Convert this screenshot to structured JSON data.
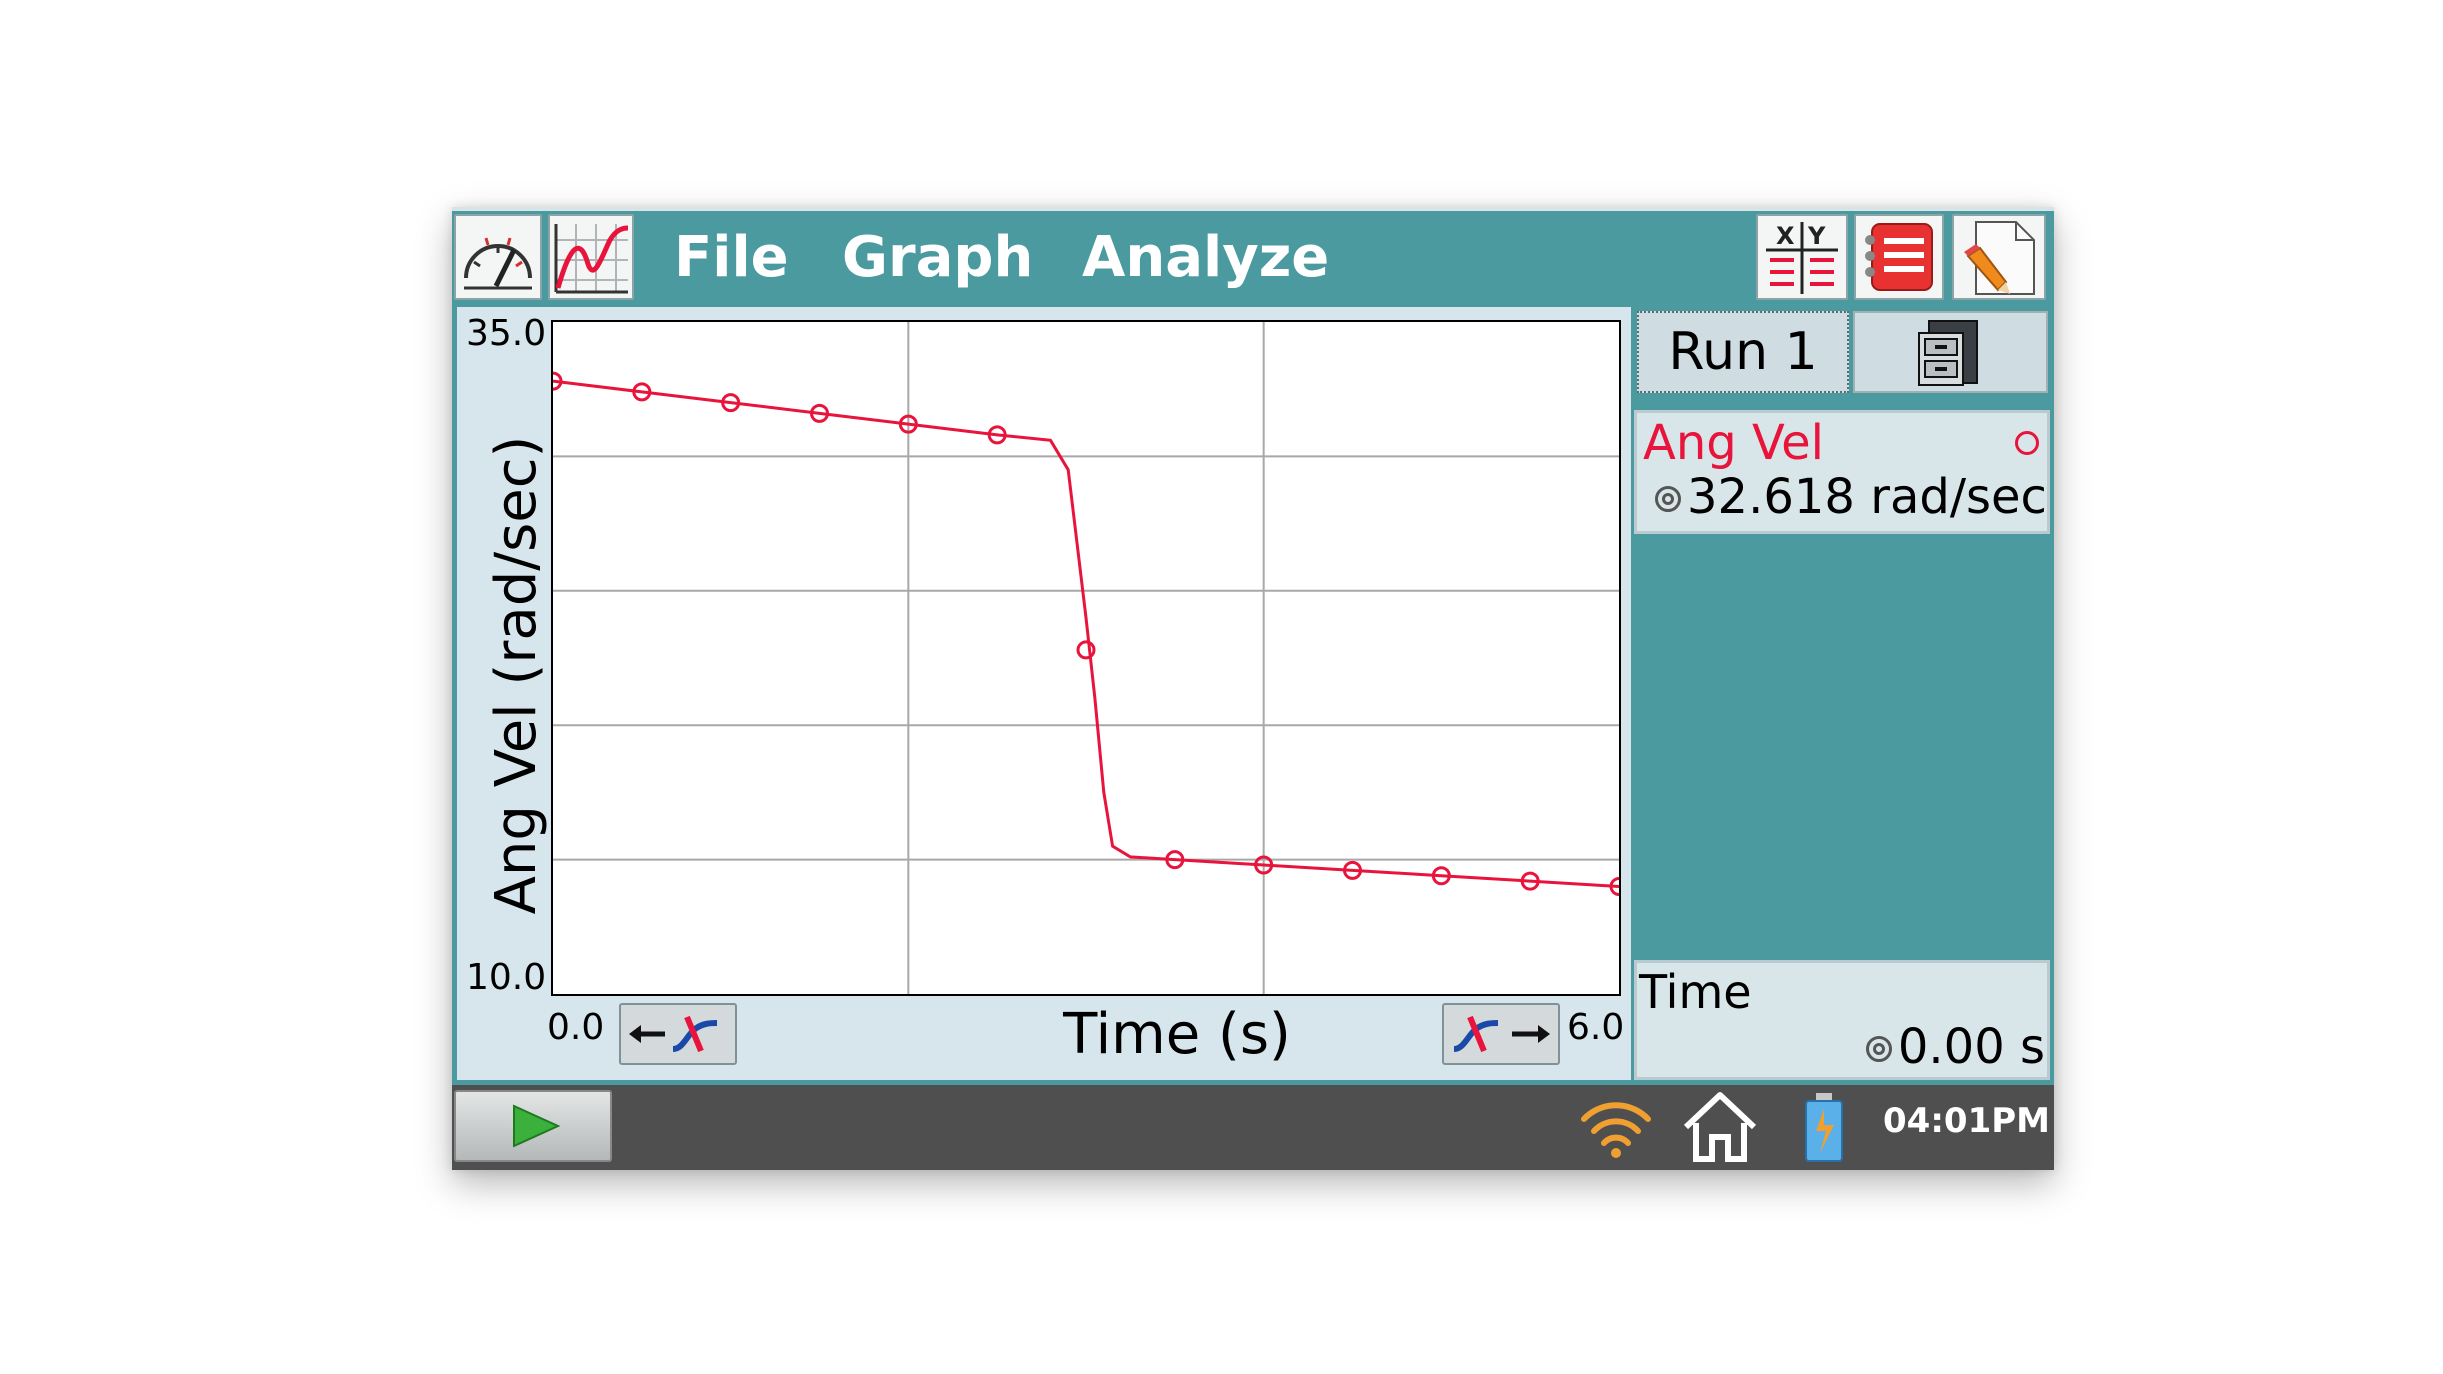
{
  "menu": {
    "file": "File",
    "graph": "Graph",
    "analyze": "Analyze"
  },
  "right_panel": {
    "run_label": "Run 1",
    "sensor_name": "Ang Vel",
    "sensor_value": "32.618 rad/sec",
    "time_name": "Time",
    "time_value": "0.00 s"
  },
  "status_bar": {
    "clock": "04:01PM"
  },
  "icons": {
    "meter": "meter-icon",
    "graph": "graph-icon",
    "table": "xy-table-icon",
    "list": "list-icon",
    "notes": "notes-icon",
    "store": "file-cabinet-icon",
    "play": "play-icon",
    "wifi": "wifi-icon",
    "home": "home-icon",
    "battery": "battery-icon"
  },
  "colors": {
    "accent": "#4a9aa0",
    "series": "#e8143c"
  },
  "chart_data": {
    "type": "line",
    "xlabel": "Time (s)",
    "ylabel": "Ang Vel (rad/sec)",
    "xlim": [
      0.0,
      6.0
    ],
    "ylim": [
      10.0,
      35.0
    ],
    "xlim_labels": [
      "0.0",
      "6.0"
    ],
    "ylim_labels": [
      "10.0",
      "35.0"
    ],
    "grid": true,
    "gridlines_x": [
      2.0,
      4.0
    ],
    "gridlines_y": [
      15.0,
      20.0,
      25.0,
      30.0
    ],
    "series": [
      {
        "x": [
          0.0,
          0.5,
          1.0,
          1.5,
          2.0,
          2.5,
          2.8,
          2.9,
          3.0,
          3.05,
          3.1,
          3.15,
          3.25,
          3.5,
          4.0,
          4.5,
          5.0,
          5.5,
          6.0
        ],
        "y": [
          32.8,
          32.4,
          32.0,
          31.6,
          31.2,
          30.8,
          30.6,
          29.5,
          24.0,
          21.0,
          17.5,
          15.5,
          15.1,
          15.0,
          14.8,
          14.6,
          14.4,
          14.2,
          14.0
        ],
        "markers_x": [
          0.0,
          0.5,
          1.0,
          1.5,
          2.0,
          2.5,
          3.0,
          3.5,
          4.0,
          4.5,
          5.0,
          5.5,
          6.0
        ],
        "markers_y": [
          32.8,
          32.4,
          32.0,
          31.6,
          31.2,
          30.8,
          22.8,
          15.0,
          14.8,
          14.6,
          14.4,
          14.2,
          14.0
        ]
      }
    ]
  }
}
